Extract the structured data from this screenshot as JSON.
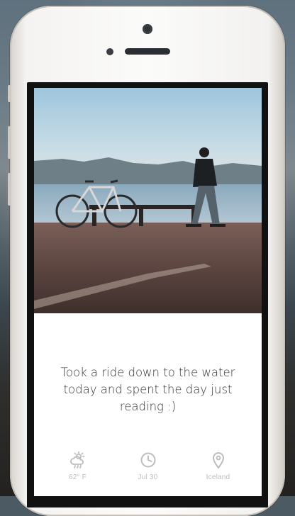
{
  "post": {
    "caption": "Took a ride down to the water today and spent the day just reading :)"
  },
  "meta": {
    "weather": {
      "icon": "weather-icon",
      "label": "62° F"
    },
    "date": {
      "icon": "clock-icon",
      "label": "Jul 30"
    },
    "location": {
      "icon": "location-pin-icon",
      "label": "Iceland"
    }
  },
  "colors": {
    "meta_gray": "#bdbdbd",
    "caption_text": "#333333"
  }
}
